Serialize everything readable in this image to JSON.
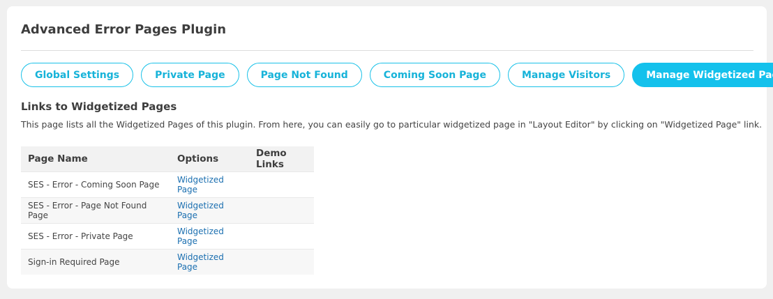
{
  "page": {
    "title": "Advanced Error Pages Plugin"
  },
  "tabs": [
    {
      "label": "Global Settings",
      "active": false
    },
    {
      "label": "Private Page",
      "active": false
    },
    {
      "label": "Page Not Found",
      "active": false
    },
    {
      "label": "Coming Soon Page",
      "active": false
    },
    {
      "label": "Manage Visitors",
      "active": false
    },
    {
      "label": "Manage Widgetized Pages",
      "active": true
    }
  ],
  "section": {
    "title": "Links to Widgetized Pages",
    "description": "This page lists all the Widgetized Pages of this plugin. From here, you can easily go to particular widgetized page in \"Layout Editor\" by clicking on \"Widgetized Page\" link."
  },
  "table": {
    "headers": [
      "Page Name",
      "Options",
      "Demo Links"
    ],
    "rows": [
      {
        "name": "SES - Error - Coming Soon Page",
        "option": "Widgetized Page",
        "demo": ""
      },
      {
        "name": "SES - Error - Page Not Found Page",
        "option": "Widgetized Page",
        "demo": ""
      },
      {
        "name": "SES - Error - Private Page",
        "option": "Widgetized Page",
        "demo": ""
      },
      {
        "name": "Sign-in Required Page",
        "option": "Widgetized Page",
        "demo": ""
      }
    ]
  },
  "colors": {
    "accent": "#14c1ec",
    "link": "#1b6fb0"
  }
}
